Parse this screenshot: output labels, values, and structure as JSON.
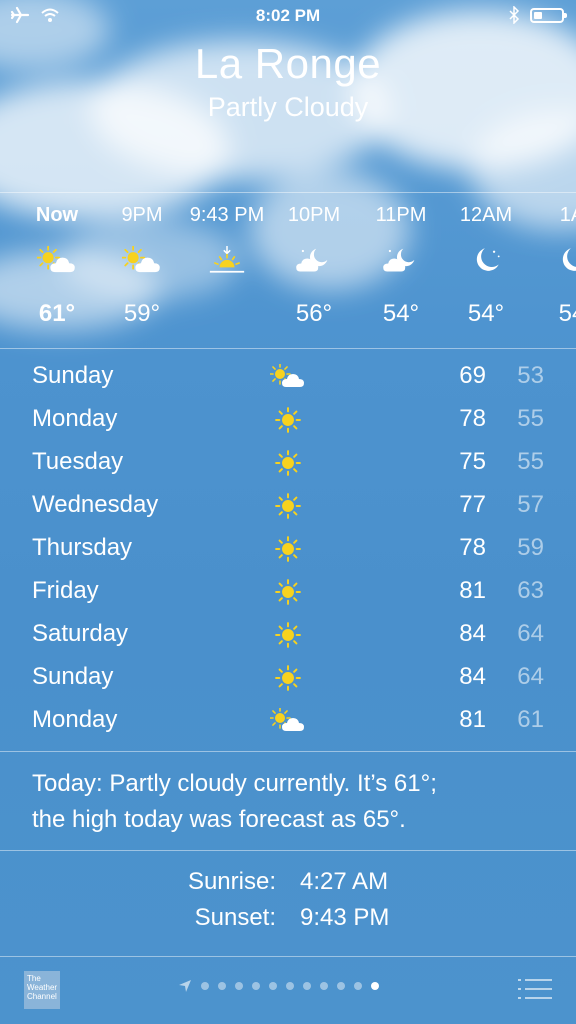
{
  "status": {
    "time": "8:02 PM",
    "battery_level": 0.3
  },
  "header": {
    "city": "La Ronge",
    "condition": "Partly Cloudy"
  },
  "hourly": [
    {
      "time": "Now",
      "icon": "partly-cloudy-day-icon",
      "temp": "61°",
      "bold": true
    },
    {
      "time": "9PM",
      "icon": "partly-cloudy-day-icon",
      "temp": "59°"
    },
    {
      "time": "9:43 PM",
      "icon": "sunset-icon",
      "temp": ""
    },
    {
      "time": "10PM",
      "icon": "partly-cloudy-night-icon",
      "temp": "56°"
    },
    {
      "time": "11PM",
      "icon": "partly-cloudy-night-icon",
      "temp": "54°"
    },
    {
      "time": "12AM",
      "icon": "moon-icon",
      "temp": "54°"
    },
    {
      "time": "1A",
      "icon": "moon-icon",
      "temp": "54"
    }
  ],
  "daily": [
    {
      "day": "Sunday",
      "icon": "partly-cloudy-icon",
      "high": "69",
      "low": "53"
    },
    {
      "day": "Monday",
      "icon": "sun-icon",
      "high": "78",
      "low": "55"
    },
    {
      "day": "Tuesday",
      "icon": "sun-icon",
      "high": "75",
      "low": "55"
    },
    {
      "day": "Wednesday",
      "icon": "sun-icon",
      "high": "77",
      "low": "57"
    },
    {
      "day": "Thursday",
      "icon": "sun-icon",
      "high": "78",
      "low": "59"
    },
    {
      "day": "Friday",
      "icon": "sun-icon",
      "high": "81",
      "low": "63"
    },
    {
      "day": "Saturday",
      "icon": "sun-icon",
      "high": "84",
      "low": "64"
    },
    {
      "day": "Sunday",
      "icon": "sun-icon",
      "high": "84",
      "low": "64"
    },
    {
      "day": "Monday",
      "icon": "partly-cloudy-icon",
      "high": "81",
      "low": "61"
    }
  ],
  "summary": {
    "line1": "Today: Partly cloudy currently. It’s 61°;",
    "line2": "the high today was forecast as 65°."
  },
  "sun": {
    "sunrise_label": "Sunrise:",
    "sunrise_value": "4:27 AM",
    "sunset_label": "Sunset:",
    "sunset_value": "9:43 PM"
  },
  "footer": {
    "logo_line1": "The",
    "logo_line2": "Weather",
    "logo_line3": "Channel",
    "page_count": 11,
    "active_page": 10
  },
  "colors": {
    "sun": "#f7d21f",
    "sky": "#4a90cc"
  }
}
